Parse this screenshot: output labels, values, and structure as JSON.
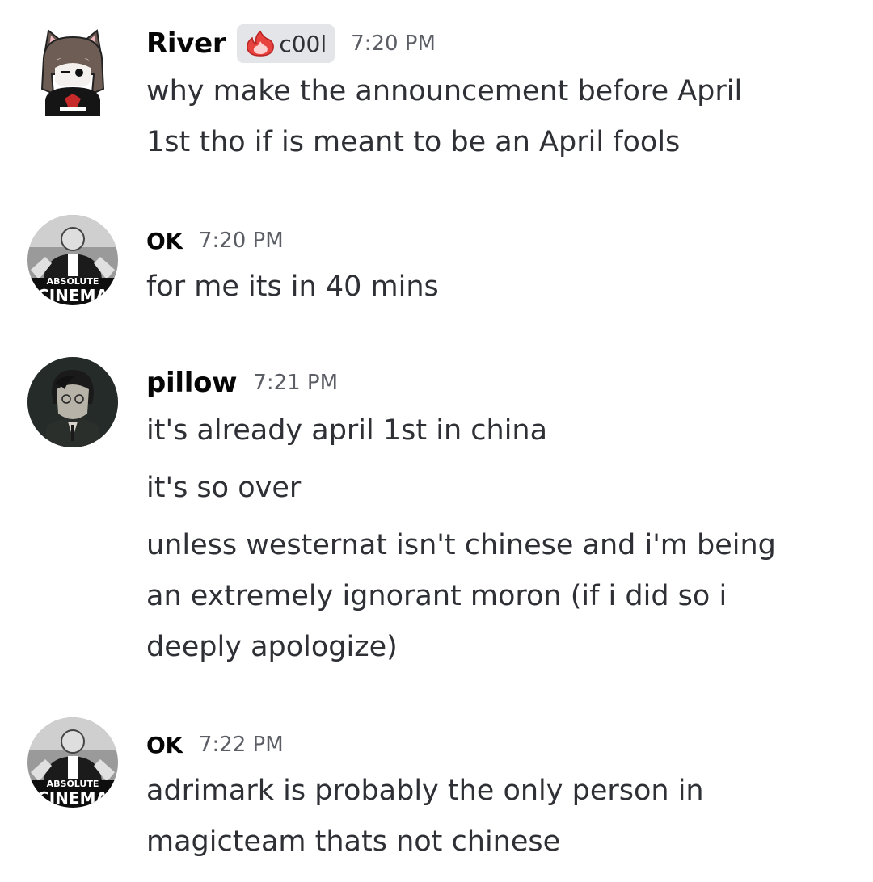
{
  "messages": [
    {
      "author": "River",
      "timestamp": "7:20 PM",
      "role_tag": {
        "label": "c00l",
        "icon": "flame-icon",
        "color": "#e8423f"
      },
      "avatar": "cat-eared-character-avatar",
      "lines": [
        [
          "why make the announcement before April",
          "1st tho if is meant to be an April fools"
        ]
      ]
    },
    {
      "author": "OK",
      "timestamp": "7:20 PM",
      "avatar": "absolute-cinema-avatar",
      "avatar_text": [
        "ABSOLUTE",
        "CINEMA"
      ],
      "lines": [
        [
          "for me its in 40 mins"
        ]
      ]
    },
    {
      "author": "pillow",
      "timestamp": "7:21 PM",
      "avatar": "anime-character-avatar",
      "lines": [
        [
          "it's already april 1st in china"
        ],
        [
          "it's so over"
        ],
        [
          "unless westernat isn't chinese and i'm being",
          "an extremely ignorant moron (if i did so i",
          "deeply apologize)"
        ]
      ]
    },
    {
      "author": "OK",
      "timestamp": "7:22 PM",
      "avatar": "absolute-cinema-avatar",
      "avatar_text": [
        "ABSOLUTE",
        "CINEMA"
      ],
      "lines": [
        [
          "adrimark is probably the only person in",
          "magicteam thats not chinese"
        ]
      ]
    }
  ]
}
